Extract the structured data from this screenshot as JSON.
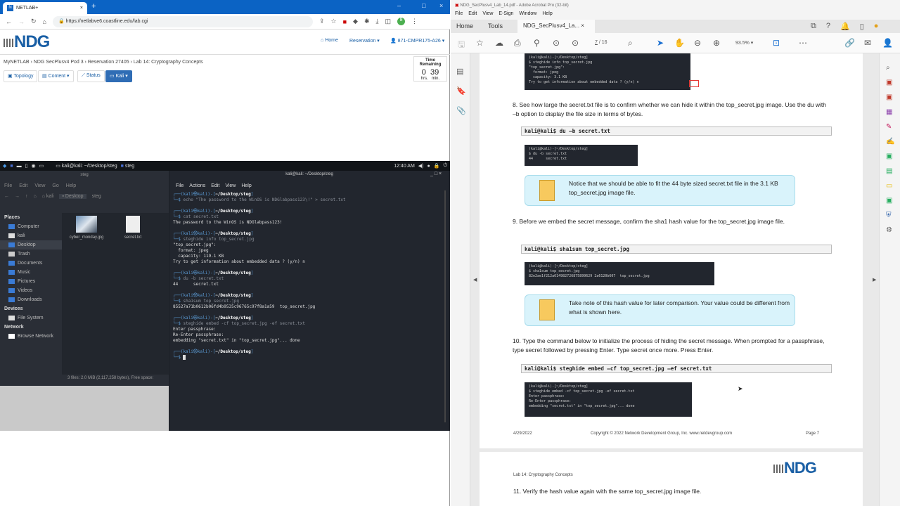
{
  "browser": {
    "tab_title": "NETLAB+",
    "url": "https://netlabve6.coastline.edu/lab.cgi",
    "profile_initial": "8"
  },
  "netlab": {
    "logo": "NDG",
    "nav": {
      "home": "Home",
      "reservation": "Reservation",
      "user": "871-CMPR175-A26"
    },
    "breadcrumb": [
      "MyNETLAB",
      "NDG SecPlusv4 Pod 3",
      "Reservation 27405",
      "Lab 14: Cryptography Concepts"
    ],
    "buttons": {
      "topology": "Topology",
      "content": "Content",
      "status": "Status",
      "kali": "Kali"
    },
    "time": {
      "label": "Time Remaining",
      "hrs": "0",
      "min": "39",
      "hrs_label": "hrs.",
      "min_label": "min."
    }
  },
  "kali": {
    "taskbar": {
      "window1": "kali@kali: ~/Desktop/steg",
      "window2": "steg",
      "clock": "12:40 AM"
    },
    "file_manager": {
      "title": "steg",
      "menu": [
        "File",
        "Edit",
        "View",
        "Go",
        "Help"
      ],
      "path": [
        "kali",
        "Desktop",
        "steg"
      ],
      "places_header": "Places",
      "places": [
        "Computer",
        "kali",
        "Desktop",
        "Trash",
        "Documents",
        "Music",
        "Pictures",
        "Videos",
        "Downloads"
      ],
      "devices_header": "Devices",
      "devices": [
        "File System"
      ],
      "network_header": "Network",
      "network": [
        "Browse Network"
      ],
      "files": [
        "cyber_monday.jpg",
        "secret.txt"
      ],
      "status": "3 files: 2.0 MiB (2,117,258 bytes), Free space:"
    },
    "terminal": {
      "title": "kali@kali: ~/Desktop/steg",
      "menu": [
        "File",
        "Actions",
        "Edit",
        "View",
        "Help"
      ],
      "prompt_user": "kali",
      "prompt_host": "kali",
      "prompt_path": "~/Desktop/steg",
      "cmd1": "echo \"The password to the WinOS is NDGlabpass123\\!\" > secret.txt",
      "cmd2": "cat secret.txt",
      "out2": "The password to the WinOS is NDGlabpass123!",
      "cmd3": "steghide info top_secret.jpg",
      "out3": "\"top_secret.jpg\":\n  format: jpeg\n  capacity: 119.1 KB\nTry to get information about embedded data ? (y/n) n",
      "cmd4": "du -b secret.txt",
      "out4": "44      secret.txt",
      "cmd5": "sha1sum top_secret.jpg",
      "out5": "85527a71b0612b06fd4b9535c96765c97f8a1a59  top_secret.jpg",
      "cmd6": "steghide embed -cf top_secret.jpg -ef secret.txt",
      "out6": "Enter passphrase:\nRe-Enter passphrase:\nembedding \"secret.txt\" in \"top_secret.jpg\"... done"
    }
  },
  "acrobat": {
    "title": "NDG_SecPlusv4_Lab_14.pdf - Adobe Acrobat Pro (32-bit)",
    "menu": [
      "File",
      "Edit",
      "View",
      "E-Sign",
      "Window",
      "Help"
    ],
    "tabs": {
      "home": "Home",
      "tools": "Tools",
      "doc": "NDG_SecPlusv4_La..."
    },
    "page_current": "7",
    "page_total": "/ 16",
    "zoom": "93.5%",
    "doc": {
      "shot_top": "(kali@kali)-[~/Desktop/steg]\n$ steghide info top_secret.jpg\n\"top_secret.jpg\":\n  format: jpeg\n  capacity: 3.1 KB\nTry to get information about embedded data ? (y/n) n",
      "step8": "8.  See how large the secret.txt file is to confirm whether we can hide it within the top_secret.jpg image. Use the du with –b option to display the file size in terms of bytes.",
      "cmd8": "kali@kali$ du –b secret.txt",
      "shot8": "(kali@kali)-[~/Desktop/steg]\n$ du -b secret.txt\n44      secret.txt",
      "note8": "Notice that we should be able to fit the 44 byte sized secret.txt file in the 3.1 KB top_secret.jpg image file.",
      "step9": "9.  Before we embed the secret message, confirm the sha1 hash value for the top_secret.jpg image file.",
      "cmd9": "kali@kali$ sha1sum top_secret.jpg",
      "shot9": "(kali@kali)-[~/Desktop/steg]\n$ sha1sum top_secret.jpg\n82e2ae1f212a614982726875899629 2a6120b607  top_secret.jpg",
      "note9": "Take note of this hash value for later comparison. Your value could be different from what is shown here.",
      "step10": "10. Type the command below to initialize the process of hiding the secret message. When prompted for a passphrase, type secret followed by pressing Enter. Type secret once more. Press Enter.",
      "cmd10": "kali@kali$ steghide embed –cf top_secret.jpg –ef secret.txt",
      "shot10": "(kali@kali)-[~/Desktop/steg]\n$ steghide embed -cf top_secret.jpg -ef secret.txt\nEnter passphrase:\nRe-Enter passphrase:\nembedding \"secret.txt\" in \"top_secret.jpg\"... done",
      "footer_date": "4/29/2022",
      "footer_copy": "Copyright © 2022 Network Development Group, Inc.  www.netdevgroup.com",
      "footer_page": "Page 7",
      "header2": "Lab 14:  Cryptography Concepts",
      "logo2": "NDG",
      "step11": "11. Verify the hash value again with the same top_secret.jpg image file."
    }
  }
}
